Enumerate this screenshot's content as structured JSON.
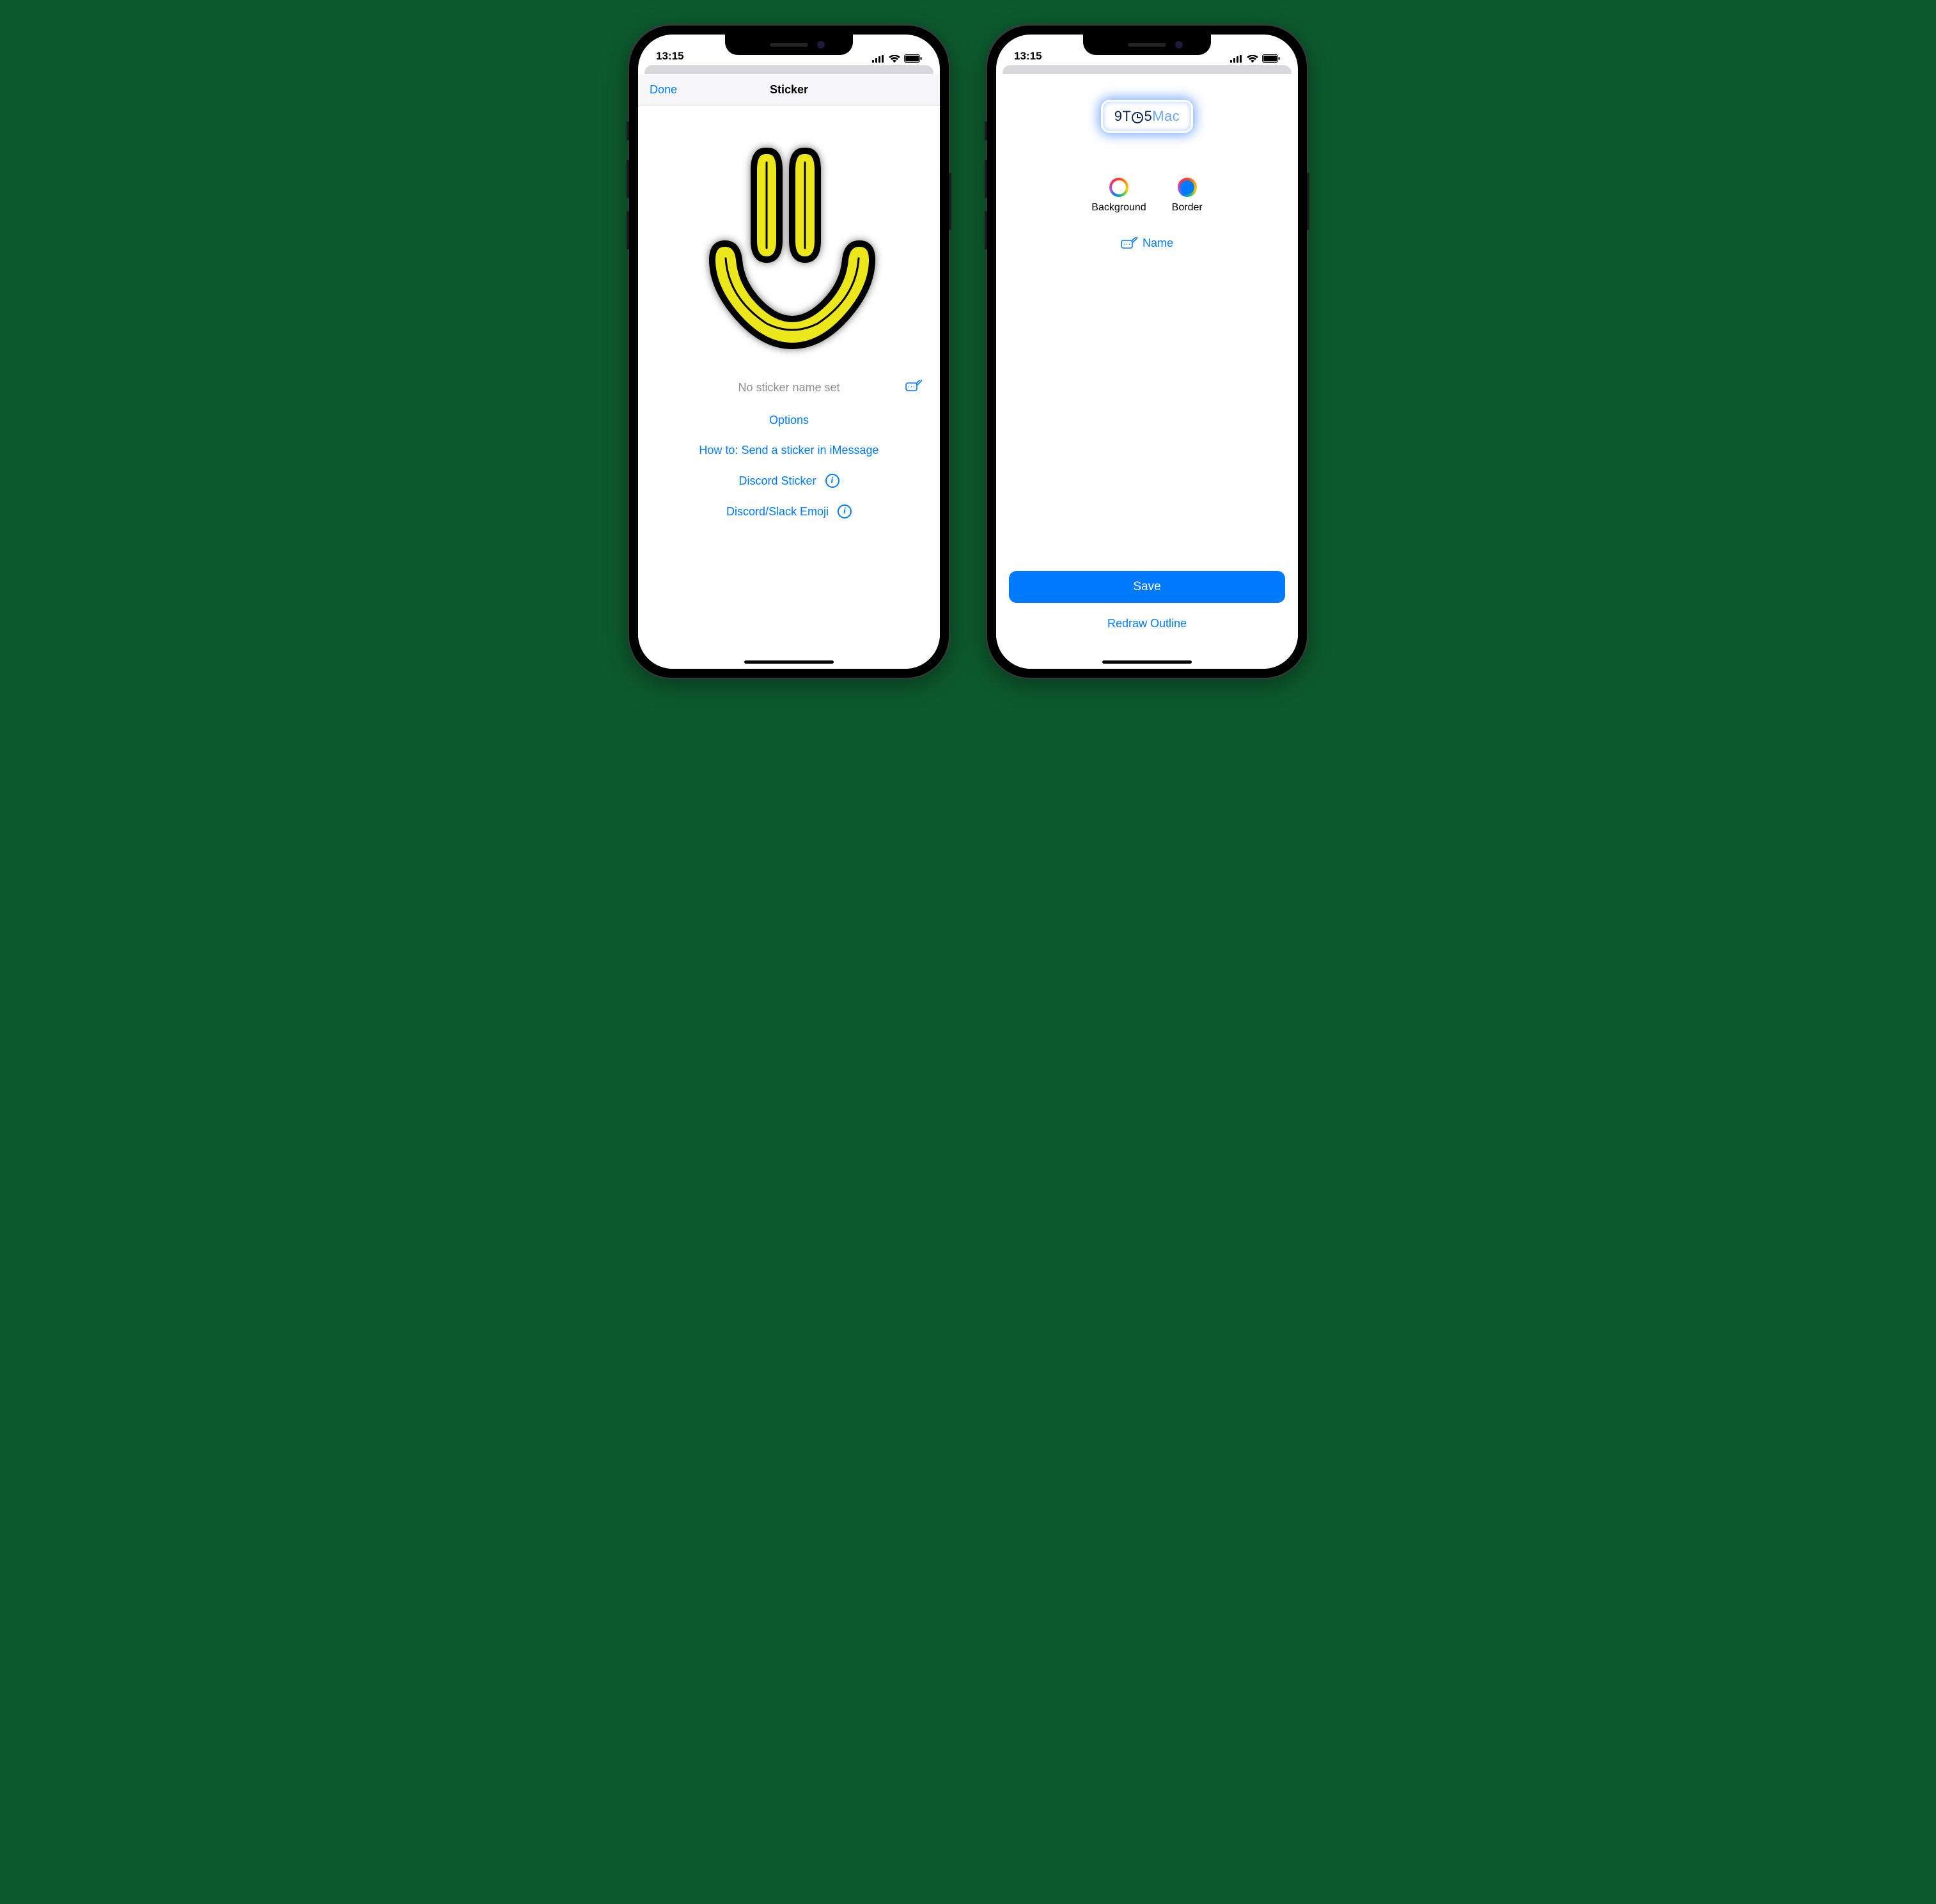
{
  "status": {
    "time": "13:15"
  },
  "left": {
    "nav": {
      "done": "Done",
      "title": "Sticker"
    },
    "sticker_name_placeholder": "No sticker name set",
    "links": {
      "options": "Options",
      "howto": "How to: Send a sticker in iMessage",
      "discord_sticker": "Discord Sticker",
      "discord_slack_emoji": "Discord/Slack Emoji"
    }
  },
  "right": {
    "logo": {
      "part1": "9T",
      "part2": "5",
      "part3": "Mac"
    },
    "options": {
      "background": "Background",
      "border": "Border"
    },
    "name_button": "Name",
    "save": "Save",
    "redraw": "Redraw Outline"
  }
}
